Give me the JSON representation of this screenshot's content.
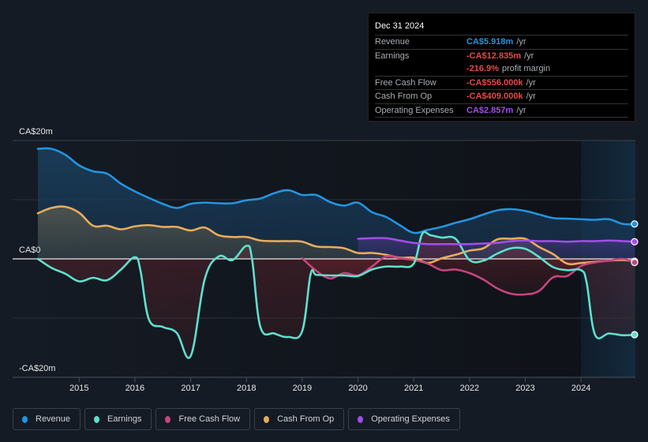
{
  "tooltip": {
    "date": "Dec 31 2024",
    "rows": [
      {
        "label": "Revenue",
        "value": "CA$5.918m",
        "unit": "/yr",
        "color": "#2394df"
      },
      {
        "label": "Earnings",
        "value": "-CA$12.835m",
        "unit": "/yr",
        "color": "#e64a4a"
      },
      {
        "label": "",
        "value": "-216.9%",
        "unit": "profit margin",
        "color": "#e64a4a"
      },
      {
        "label": "Free Cash Flow",
        "value": "-CA$556.000k",
        "unit": "/yr",
        "color": "#e64a4a"
      },
      {
        "label": "Cash From Op",
        "value": "-CA$409.000k",
        "unit": "/yr",
        "color": "#e64a4a"
      },
      {
        "label": "Operating Expenses",
        "value": "CA$2.857m",
        "unit": "/yr",
        "color": "#a24ee8"
      }
    ]
  },
  "legend": [
    {
      "label": "Revenue",
      "color": "#2394df"
    },
    {
      "label": "Earnings",
      "color": "#5ee0cc"
    },
    {
      "label": "Free Cash Flow",
      "color": "#c4457f"
    },
    {
      "label": "Cash From Op",
      "color": "#e8ac5b"
    },
    {
      "label": "Operating Expenses",
      "color": "#a24ee8"
    }
  ],
  "chart_data": {
    "type": "line",
    "title": "",
    "xlabel": "",
    "ylabel": "",
    "y_tick_labels": [
      "CA$20m",
      "CA$0",
      "-CA$20m"
    ],
    "ylim": [
      -20,
      20
    ],
    "xlim": [
      2014.26,
      2024.96
    ],
    "x_tick_labels": [
      "2015",
      "2016",
      "2017",
      "2018",
      "2019",
      "2020",
      "2021",
      "2022",
      "2023",
      "2024"
    ],
    "x_ticks": [
      2015,
      2016,
      2017,
      2018,
      2019,
      2020,
      2021,
      2022,
      2023,
      2024
    ],
    "grid": true,
    "legend_position": "bottom",
    "highlight_start": 2024.0,
    "series": [
      {
        "name": "Revenue",
        "color": "#2394df",
        "x": [
          2014.26,
          2014.5,
          2014.75,
          2015.0,
          2015.25,
          2015.5,
          2015.75,
          2016.0,
          2016.25,
          2016.5,
          2016.75,
          2017.0,
          2017.25,
          2017.5,
          2017.75,
          2018.0,
          2018.25,
          2018.5,
          2018.75,
          2019.0,
          2019.25,
          2019.5,
          2019.75,
          2020.0,
          2020.25,
          2020.5,
          2020.75,
          2021.0,
          2021.25,
          2021.5,
          2021.75,
          2022.0,
          2022.25,
          2022.5,
          2022.75,
          2023.0,
          2023.25,
          2023.5,
          2023.75,
          2024.0,
          2024.25,
          2024.5,
          2024.75,
          2024.96
        ],
        "values": [
          18.6,
          18.6,
          17.6,
          15.8,
          14.8,
          14.4,
          12.7,
          11.4,
          10.3,
          9.3,
          8.6,
          9.3,
          9.5,
          9.4,
          9.4,
          9.9,
          10.2,
          11.1,
          11.6,
          10.8,
          10.8,
          9.6,
          9.0,
          9.5,
          7.9,
          7.1,
          5.7,
          4.4,
          4.9,
          5.4,
          6.1,
          6.7,
          7.5,
          8.2,
          8.4,
          8.1,
          7.5,
          6.9,
          6.8,
          6.7,
          6.6,
          6.7,
          5.9,
          5.9
        ]
      },
      {
        "name": "Earnings",
        "color": "#5ee0cc",
        "x": [
          2014.26,
          2014.5,
          2014.75,
          2015.0,
          2015.25,
          2015.5,
          2015.75,
          2016.0,
          2016.1,
          2016.25,
          2016.5,
          2016.75,
          2017.0,
          2017.25,
          2017.5,
          2017.75,
          2018.0,
          2018.1,
          2018.25,
          2018.5,
          2018.75,
          2019.0,
          2019.15,
          2019.25,
          2019.5,
          2019.75,
          2020.0,
          2020.25,
          2020.5,
          2020.75,
          2021.0,
          2021.15,
          2021.3,
          2021.5,
          2021.75,
          2022.0,
          2022.25,
          2022.5,
          2022.75,
          2023.0,
          2023.25,
          2023.5,
          2023.75,
          2024.0,
          2024.1,
          2024.25,
          2024.5,
          2024.75,
          2024.96
        ],
        "values": [
          0.0,
          -1.5,
          -2.5,
          -3.8,
          -3.2,
          -3.6,
          -1.8,
          0.3,
          -2.0,
          -10.2,
          -11.5,
          -12.5,
          -16.4,
          -3.5,
          0.4,
          -0.2,
          2.2,
          0.0,
          -11.5,
          -12.6,
          -13.2,
          -12.2,
          -2.6,
          -2.7,
          -2.8,
          -2.8,
          -2.9,
          -1.8,
          -1.3,
          -1.3,
          -0.8,
          4.2,
          4.0,
          3.6,
          3.4,
          -0.2,
          -0.3,
          0.9,
          1.8,
          1.7,
          0.3,
          -1.4,
          -1.9,
          -1.9,
          -4.0,
          -12.8,
          -12.6,
          -12.9,
          -12.8
        ]
      },
      {
        "name": "Free Cash Flow",
        "color": "#c4457f",
        "x": [
          2019.0,
          2019.25,
          2019.5,
          2019.75,
          2020.0,
          2020.25,
          2020.5,
          2020.75,
          2021.0,
          2021.25,
          2021.5,
          2021.75,
          2022.0,
          2022.25,
          2022.5,
          2022.75,
          2023.0,
          2023.25,
          2023.5,
          2023.75,
          2024.0,
          2024.25,
          2024.5,
          2024.75,
          2024.96
        ],
        "values": [
          0.1,
          -2.0,
          -3.3,
          -2.4,
          -2.8,
          -1.3,
          0.4,
          0.1,
          -0.2,
          -0.8,
          -1.9,
          -1.8,
          -2.4,
          -3.5,
          -5.0,
          -5.9,
          -6.0,
          -5.4,
          -3.1,
          -2.9,
          -1.2,
          -0.6,
          -0.3,
          0.0,
          -0.6
        ]
      },
      {
        "name": "Cash From Op",
        "color": "#e8ac5b",
        "x": [
          2014.26,
          2014.5,
          2014.75,
          2015.0,
          2015.25,
          2015.5,
          2015.75,
          2016.0,
          2016.25,
          2016.5,
          2016.75,
          2017.0,
          2017.25,
          2017.5,
          2017.75,
          2018.0,
          2018.25,
          2018.5,
          2018.75,
          2019.0,
          2019.25,
          2019.5,
          2019.75,
          2020.0,
          2020.25,
          2020.5,
          2020.75,
          2021.0,
          2021.25,
          2021.5,
          2021.75,
          2022.0,
          2022.25,
          2022.5,
          2022.75,
          2023.0,
          2023.25,
          2023.5,
          2023.75,
          2024.0,
          2024.25,
          2024.5,
          2024.75,
          2024.96
        ],
        "values": [
          7.7,
          8.6,
          8.8,
          7.8,
          5.6,
          5.6,
          5.0,
          5.5,
          5.7,
          5.4,
          5.4,
          4.8,
          5.3,
          4.0,
          3.7,
          3.7,
          3.1,
          3.0,
          3.0,
          2.9,
          2.1,
          2.0,
          1.8,
          1.0,
          1.0,
          0.7,
          0.2,
          0.2,
          -0.7,
          0.1,
          0.7,
          1.4,
          1.8,
          3.3,
          3.4,
          3.4,
          2.0,
          0.8,
          -0.8,
          -0.7,
          -0.5,
          -0.3,
          -0.2,
          -0.4
        ]
      },
      {
        "name": "Operating Expenses",
        "color": "#a24ee8",
        "x": [
          2020.0,
          2020.25,
          2020.5,
          2020.75,
          2021.0,
          2021.25,
          2021.5,
          2021.75,
          2022.0,
          2022.25,
          2022.5,
          2022.75,
          2023.0,
          2023.25,
          2023.5,
          2023.75,
          2024.0,
          2024.25,
          2024.5,
          2024.75,
          2024.96
        ],
        "values": [
          3.4,
          3.5,
          3.5,
          3.1,
          2.7,
          2.5,
          2.5,
          2.5,
          2.5,
          2.6,
          2.7,
          3.0,
          3.1,
          3.0,
          3.0,
          2.9,
          3.0,
          3.0,
          3.1,
          3.0,
          2.9
        ]
      }
    ]
  }
}
